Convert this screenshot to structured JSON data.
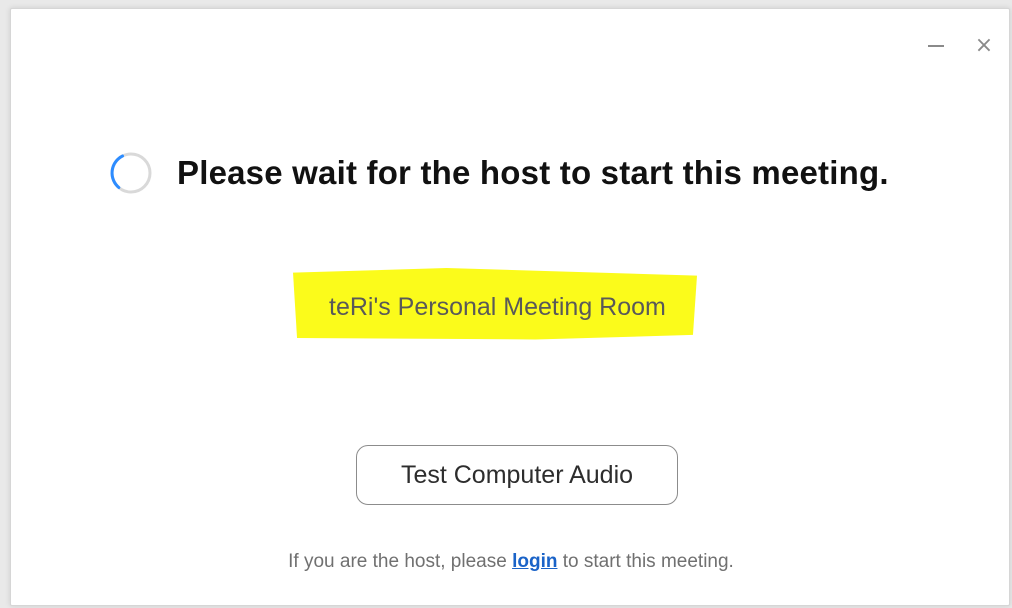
{
  "window": {
    "controls": {
      "minimize_icon": "minimize-icon",
      "close_label": "×"
    }
  },
  "status": {
    "spinner_icon": "loading-spinner-icon",
    "message": "Please wait for the host to start this meeting."
  },
  "meeting": {
    "name": "teRi's Personal Meeting Room",
    "highlight_color": "#fbfb1b"
  },
  "audio_button": {
    "label": "Test Computer Audio"
  },
  "host_prompt": {
    "prefix": "If you are the host, please ",
    "link_label": "login",
    "suffix": " to start this meeting.",
    "link_color": "#1a63c8"
  }
}
